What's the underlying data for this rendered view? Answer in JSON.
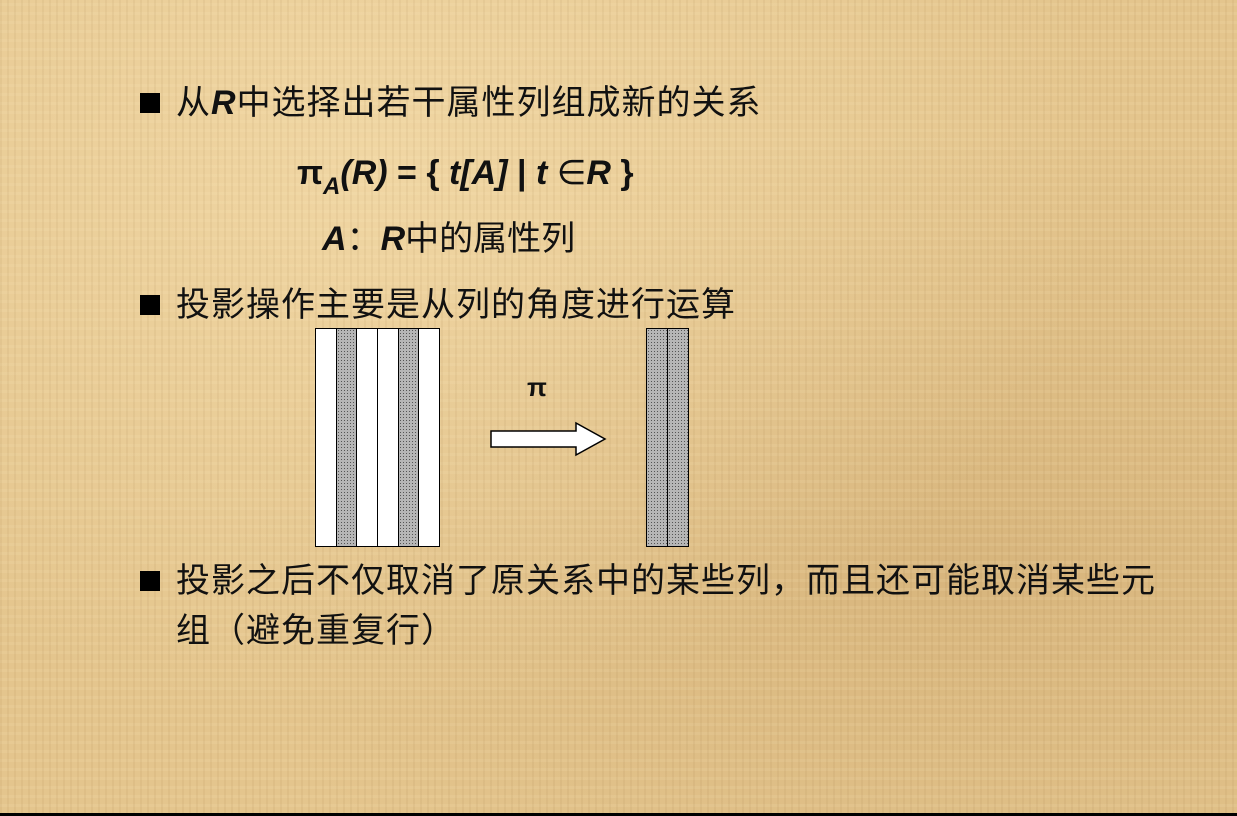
{
  "bullets": [
    {
      "prefix": "从",
      "italic": "R",
      "suffix": "中选择出若干属性列组成新的关系"
    },
    {
      "text": "投影操作主要是从列的角度进行运算"
    },
    {
      "text": "投影之后不仅取消了原关系中的某些列，而且还可能取消某些元组（避免重复行）"
    }
  ],
  "formula": {
    "pi": "π",
    "sub": "A",
    "arg": "(R)",
    "rhs_open": " = { ",
    "t": "t",
    "bracket": "[A]",
    "bar": " | ",
    "t2": "t",
    "elem": " ∈",
    "R": "R",
    "close": " }"
  },
  "attr_def": {
    "A": "A",
    "colon": "：",
    "R": "R",
    "rest": "中的属性列"
  },
  "diagram": {
    "operator_label": "π",
    "source_columns": [
      "plain",
      "dotted",
      "plain",
      "plain",
      "dotted",
      "plain"
    ],
    "result_columns": [
      "dotted",
      "dotted"
    ]
  }
}
